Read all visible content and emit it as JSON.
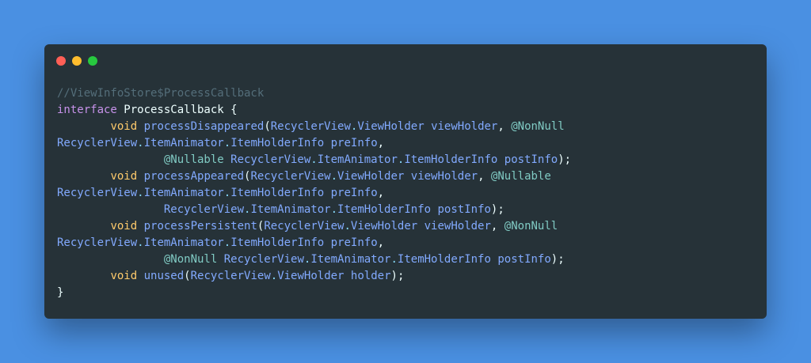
{
  "colors": {
    "background": "#4a90e2",
    "window": "#263238",
    "dot_red": "#ff5f56",
    "dot_yellow": "#ffbd2e",
    "dot_green": "#27c93f"
  },
  "window": {
    "controls": [
      {
        "name": "close",
        "icon": "red-circle-icon"
      },
      {
        "name": "minimize",
        "icon": "yellow-circle-icon"
      },
      {
        "name": "maximize",
        "icon": "green-circle-icon"
      }
    ]
  },
  "code": {
    "lines": [
      [
        {
          "t": "//ViewInfoStore$ProcessCallback",
          "c": "comment"
        }
      ],
      [
        {
          "t": "interface",
          "c": "keyword"
        },
        {
          "t": " ProcessCallback {",
          "c": "plain"
        }
      ],
      [
        {
          "t": "        ",
          "c": "plain"
        },
        {
          "t": "void",
          "c": "void"
        },
        {
          "t": " processDisappeared",
          "c": "type"
        },
        {
          "t": "(",
          "c": "punct"
        },
        {
          "t": "RecyclerView",
          "c": "type"
        },
        {
          "t": ".",
          "c": "dot"
        },
        {
          "t": "ViewHolder",
          "c": "type"
        },
        {
          "t": " viewHolder",
          "c": "param"
        },
        {
          "t": ", ",
          "c": "punct"
        },
        {
          "t": "@NonNull",
          "c": "annot"
        }
      ],
      [
        {
          "t": "RecyclerView",
          "c": "type"
        },
        {
          "t": ".",
          "c": "dot"
        },
        {
          "t": "ItemAnimator",
          "c": "type"
        },
        {
          "t": ".",
          "c": "dot"
        },
        {
          "t": "ItemHolderInfo",
          "c": "type"
        },
        {
          "t": " preInfo",
          "c": "param"
        },
        {
          "t": ",",
          "c": "punct"
        }
      ],
      [
        {
          "t": "                ",
          "c": "plain"
        },
        {
          "t": "@Nullable",
          "c": "annot"
        },
        {
          "t": " RecyclerView",
          "c": "type"
        },
        {
          "t": ".",
          "c": "dot"
        },
        {
          "t": "ItemAnimator",
          "c": "type"
        },
        {
          "t": ".",
          "c": "dot"
        },
        {
          "t": "ItemHolderInfo",
          "c": "type"
        },
        {
          "t": " postInfo",
          "c": "param"
        },
        {
          "t": ");",
          "c": "punct"
        }
      ],
      [
        {
          "t": "        ",
          "c": "plain"
        },
        {
          "t": "void",
          "c": "void"
        },
        {
          "t": " processAppeared",
          "c": "type"
        },
        {
          "t": "(",
          "c": "punct"
        },
        {
          "t": "RecyclerView",
          "c": "type"
        },
        {
          "t": ".",
          "c": "dot"
        },
        {
          "t": "ViewHolder",
          "c": "type"
        },
        {
          "t": " viewHolder",
          "c": "param"
        },
        {
          "t": ", ",
          "c": "punct"
        },
        {
          "t": "@Nullable",
          "c": "annot"
        }
      ],
      [
        {
          "t": "RecyclerView",
          "c": "type"
        },
        {
          "t": ".",
          "c": "dot"
        },
        {
          "t": "ItemAnimator",
          "c": "type"
        },
        {
          "t": ".",
          "c": "dot"
        },
        {
          "t": "ItemHolderInfo",
          "c": "type"
        },
        {
          "t": " preInfo",
          "c": "param"
        },
        {
          "t": ",",
          "c": "punct"
        }
      ],
      [
        {
          "t": "                ",
          "c": "plain"
        },
        {
          "t": "RecyclerView",
          "c": "type"
        },
        {
          "t": ".",
          "c": "dot"
        },
        {
          "t": "ItemAnimator",
          "c": "type"
        },
        {
          "t": ".",
          "c": "dot"
        },
        {
          "t": "ItemHolderInfo",
          "c": "type"
        },
        {
          "t": " postInfo",
          "c": "param"
        },
        {
          "t": ");",
          "c": "punct"
        }
      ],
      [
        {
          "t": "        ",
          "c": "plain"
        },
        {
          "t": "void",
          "c": "void"
        },
        {
          "t": " processPersistent",
          "c": "type"
        },
        {
          "t": "(",
          "c": "punct"
        },
        {
          "t": "RecyclerView",
          "c": "type"
        },
        {
          "t": ".",
          "c": "dot"
        },
        {
          "t": "ViewHolder",
          "c": "type"
        },
        {
          "t": " viewHolder",
          "c": "param"
        },
        {
          "t": ", ",
          "c": "punct"
        },
        {
          "t": "@NonNull",
          "c": "annot"
        }
      ],
      [
        {
          "t": "RecyclerView",
          "c": "type"
        },
        {
          "t": ".",
          "c": "dot"
        },
        {
          "t": "ItemAnimator",
          "c": "type"
        },
        {
          "t": ".",
          "c": "dot"
        },
        {
          "t": "ItemHolderInfo",
          "c": "type"
        },
        {
          "t": " preInfo",
          "c": "param"
        },
        {
          "t": ",",
          "c": "punct"
        }
      ],
      [
        {
          "t": "                ",
          "c": "plain"
        },
        {
          "t": "@NonNull",
          "c": "annot"
        },
        {
          "t": " RecyclerView",
          "c": "type"
        },
        {
          "t": ".",
          "c": "dot"
        },
        {
          "t": "ItemAnimator",
          "c": "type"
        },
        {
          "t": ".",
          "c": "dot"
        },
        {
          "t": "ItemHolderInfo",
          "c": "type"
        },
        {
          "t": " postInfo",
          "c": "param"
        },
        {
          "t": ");",
          "c": "punct"
        }
      ],
      [
        {
          "t": "        ",
          "c": "plain"
        },
        {
          "t": "void",
          "c": "void"
        },
        {
          "t": " unused",
          "c": "type"
        },
        {
          "t": "(",
          "c": "punct"
        },
        {
          "t": "RecyclerView",
          "c": "type"
        },
        {
          "t": ".",
          "c": "dot"
        },
        {
          "t": "ViewHolder",
          "c": "type"
        },
        {
          "t": " holder",
          "c": "param"
        },
        {
          "t": ");",
          "c": "punct"
        }
      ],
      [
        {
          "t": "}",
          "c": "plain"
        }
      ]
    ]
  }
}
